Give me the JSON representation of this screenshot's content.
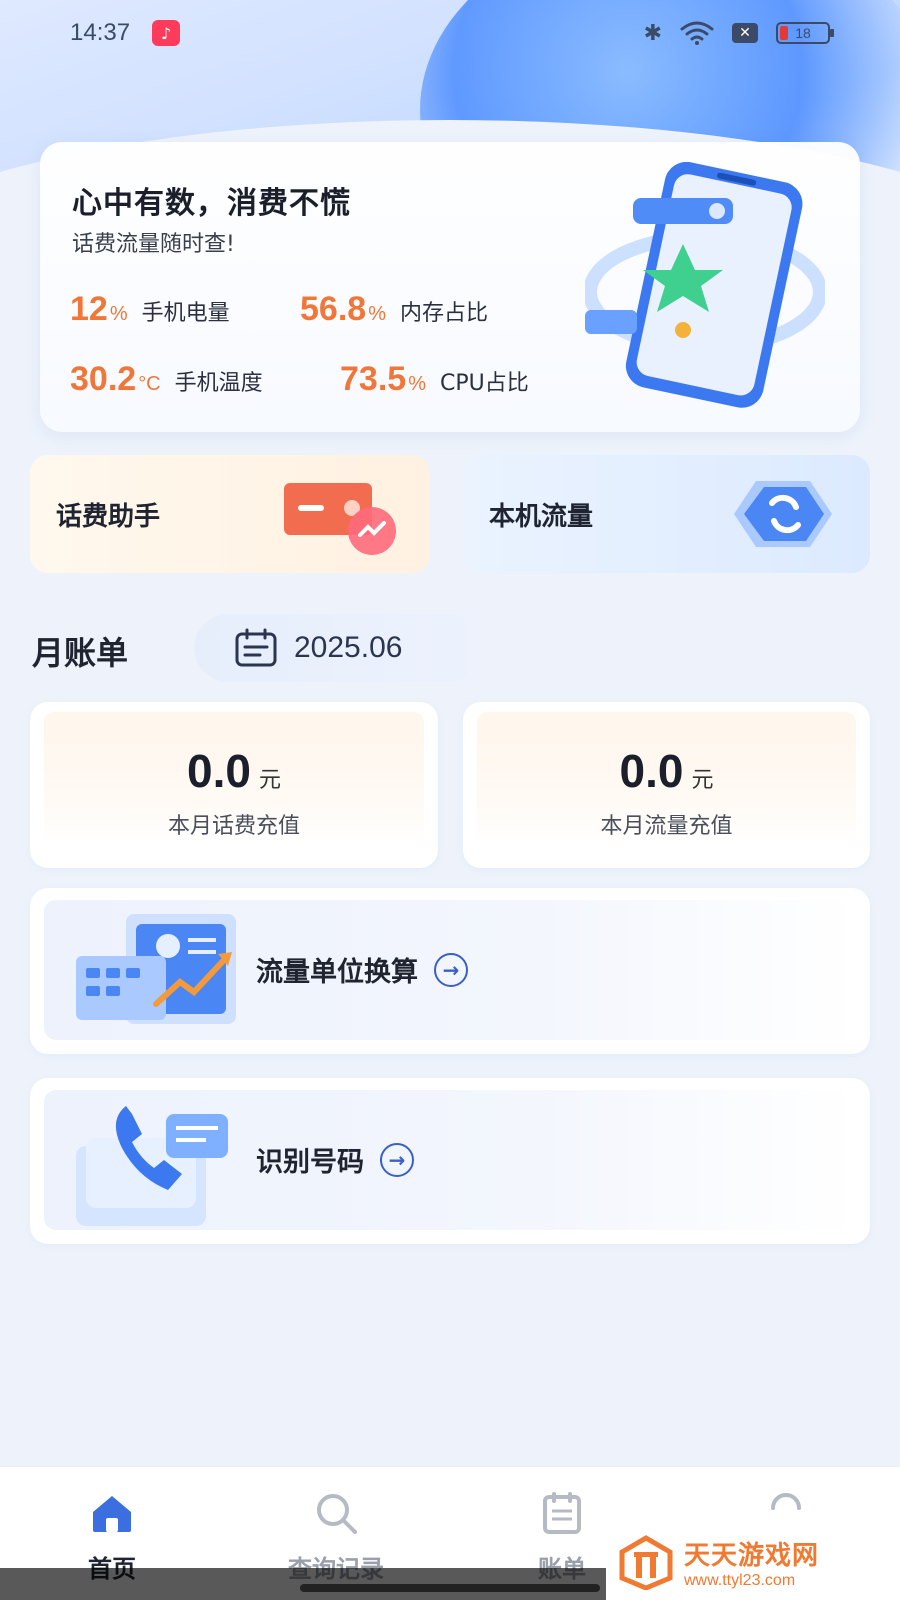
{
  "status_bar": {
    "time": "14:37",
    "battery_level": "18",
    "icons": [
      "music-app-icon",
      "bluetooth-icon",
      "wifi-icon",
      "sim-off-icon",
      "battery-icon"
    ]
  },
  "hero": {
    "title": "心中有数，消费不慌",
    "subtitle": "话费流量随时查!",
    "stats": [
      {
        "value": "12",
        "unit": "%",
        "label": "手机电量"
      },
      {
        "value": "56.8",
        "unit": "%",
        "label": "内存占比"
      },
      {
        "value": "30.2",
        "unit": "°C",
        "label": "手机温度"
      },
      {
        "value": "73.5",
        "unit": "%",
        "label": "CPU占比"
      }
    ]
  },
  "tiles": {
    "left": {
      "label": "话费助手",
      "icon": "card-chart-icon"
    },
    "right": {
      "label": "本机流量",
      "icon": "refresh-badge-icon"
    }
  },
  "bill": {
    "title": "月账单",
    "date": "2025.06",
    "cards": [
      {
        "amount": "0.0",
        "unit": "元",
        "label": "本月话费充值"
      },
      {
        "amount": "0.0",
        "unit": "元",
        "label": "本月流量充值"
      }
    ]
  },
  "features": [
    {
      "label": "流量单位换算",
      "icon": "calculator-chart-icon"
    },
    {
      "label": "识别号码",
      "icon": "phone-message-icon"
    }
  ],
  "nav": {
    "items": [
      {
        "label": "首页",
        "icon": "home-icon",
        "active": true
      },
      {
        "label": "查询记录",
        "icon": "search-icon",
        "active": false
      },
      {
        "label": "账单",
        "icon": "bill-icon",
        "active": false
      },
      {
        "label": "",
        "icon": "profile-icon",
        "active": false
      }
    ]
  },
  "watermark": {
    "name": "天天游戏网",
    "url": "www.ttyl23.com"
  },
  "colors": {
    "accent_orange": "#f0773a",
    "primary_blue": "#3b6fe0",
    "background": "#eef3fb"
  }
}
